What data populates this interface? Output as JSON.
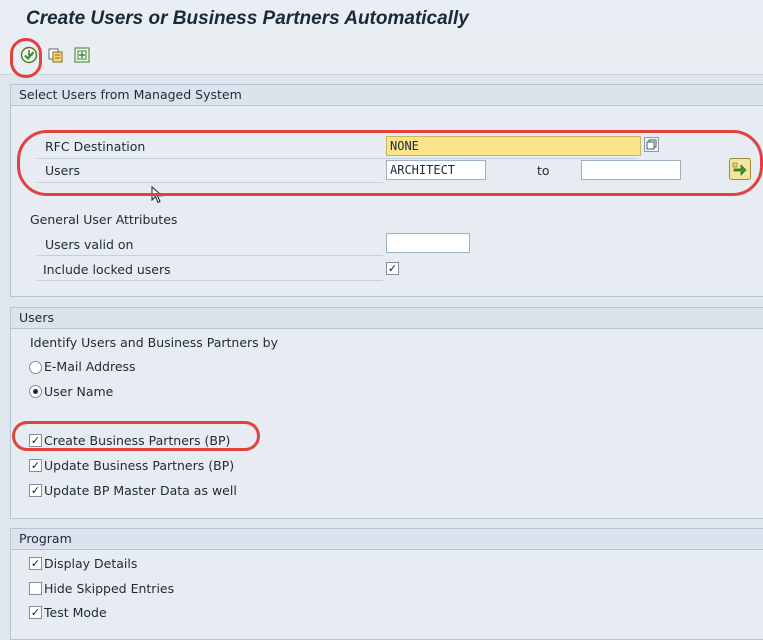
{
  "window": {
    "title": "Create Users or Business Partners Automatically"
  },
  "toolbar": {
    "icons": [
      "execute-icon",
      "copy-icon",
      "variant-icon"
    ]
  },
  "select_section": {
    "header": "Select Users from Managed System",
    "rfc_label": "RFC Destination",
    "rfc_value": "NONE",
    "users_label": "Users",
    "users_from": "ARCHITECT",
    "to_label": "to",
    "users_to": "",
    "general_heading": "General User Attributes",
    "valid_on_label": "Users valid on",
    "valid_on_value": "",
    "include_locked_label": "Include locked users",
    "include_locked_checked": true
  },
  "users_section": {
    "header": "Users",
    "identify_label": "Identify Users and Business Partners by",
    "options": [
      {
        "label": "E-Mail Address",
        "selected": false
      },
      {
        "label": "User Name",
        "selected": true
      }
    ],
    "checkboxes": [
      {
        "label": "Create Business Partners (BP)",
        "checked": true
      },
      {
        "label": "Update Business Partners (BP)",
        "checked": true
      },
      {
        "label": "Update BP Master Data as well",
        "checked": true
      }
    ]
  },
  "program_section": {
    "header": "Program",
    "checkboxes": [
      {
        "label": "Display Details",
        "checked": true
      },
      {
        "label": "Hide Skipped Entries",
        "checked": false
      },
      {
        "label": "Test Mode",
        "checked": true
      }
    ]
  },
  "colors": {
    "highlight": "#e2413e",
    "required_field": "#fbe48a"
  }
}
